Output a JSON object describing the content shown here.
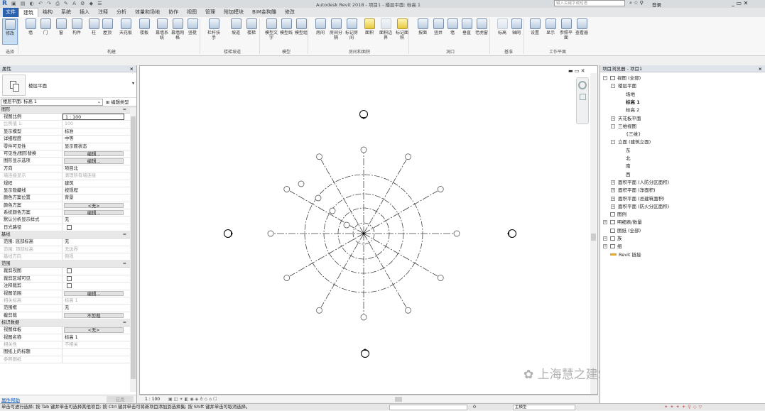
{
  "app": {
    "title": "Autodesk Revit 2018 -    项目1 - 楼层平面: 标高 1",
    "search_placeholder": "键入关键字或短语",
    "login": "登录"
  },
  "tabs": [
    "建筑",
    "结构",
    "系统",
    "插入",
    "注释",
    "分析",
    "体量和场地",
    "协作",
    "视图",
    "管理",
    "附加模块",
    "BIM金狗雕",
    "修改"
  ],
  "ribbon": {
    "buttons": [
      "修改",
      "墙",
      "门",
      "窗",
      "构件",
      "柱",
      "屋顶",
      "天花板",
      "楼板",
      "幕墙系统",
      "幕墙网格",
      "竖梃",
      "栏杆扶手",
      "坡道",
      "楼梯",
      "模型文字",
      "模型线",
      "模型组",
      "房间",
      "房间分隔",
      "标记房间",
      "面积",
      "面积边界",
      "标记面积",
      "按面",
      "竖井",
      "墙",
      "垂直",
      "老虎窗",
      "标高",
      "轴网",
      "设置",
      "显示",
      "参照平面",
      "查看器"
    ],
    "groups": [
      "选择",
      "构建",
      "楼梯坡道",
      "模型",
      "房间和面积",
      "洞口",
      "基准",
      "工作平面"
    ]
  },
  "properties": {
    "title": "属性",
    "type_name": "楼层平面",
    "selector": "楼层平面: 标高 1",
    "edit_type": "编辑类型",
    "sections": [
      {
        "name": "图形",
        "rows": [
          {
            "k": "视图比例",
            "v": "1 : 100"
          },
          {
            "k": "比例值 1:",
            "v": "100",
            "dim": true
          },
          {
            "k": "显示模型",
            "v": "标准"
          },
          {
            "k": "详细程度",
            "v": "中等"
          },
          {
            "k": "零件可见性",
            "v": "显示原状态"
          },
          {
            "k": "可见性/图形替换",
            "btn": "编辑..."
          },
          {
            "k": "图形显示选项",
            "btn": "编辑..."
          },
          {
            "k": "方向",
            "v": "项目北"
          },
          {
            "k": "墙连接显示",
            "v": "清理所有墙连接",
            "dim": true
          },
          {
            "k": "规程",
            "v": "建筑"
          },
          {
            "k": "显示隐藏线",
            "v": "按规程"
          },
          {
            "k": "颜色方案位置",
            "v": "背景"
          },
          {
            "k": "颜色方案",
            "btn": "<无>"
          },
          {
            "k": "系统颜色方案",
            "btn": "编辑..."
          },
          {
            "k": "默认分析显示样式",
            "v": "无"
          },
          {
            "k": "日光路径",
            "cb": true
          }
        ]
      },
      {
        "name": "基线",
        "rows": [
          {
            "k": "范围: 底部标高",
            "v": "无"
          },
          {
            "k": "范围: 顶部标高",
            "v": "无边界",
            "dim": true
          },
          {
            "k": "基线方向",
            "v": "俯视",
            "dim": true
          }
        ]
      },
      {
        "name": "范围",
        "rows": [
          {
            "k": "裁剪视图",
            "cb": true
          },
          {
            "k": "裁剪区域可见",
            "cb": true
          },
          {
            "k": "注释裁剪",
            "cb": true
          },
          {
            "k": "视图范围",
            "btn": "编辑..."
          },
          {
            "k": "相关标高",
            "v": "标高 1",
            "dim": true
          },
          {
            "k": "范围框",
            "v": "无"
          },
          {
            "k": "截剪裁",
            "btn": "不剪裁"
          }
        ]
      },
      {
        "name": "标识数据",
        "rows": [
          {
            "k": "视图样板",
            "btn": "<无>"
          },
          {
            "k": "视图名称",
            "v": "标高 1"
          },
          {
            "k": "相关性",
            "v": "不相关",
            "dim": true
          },
          {
            "k": "图纸上的标题",
            "v": ""
          },
          {
            "k": "参照图纸",
            "v": "",
            "dim": true
          }
        ]
      }
    ],
    "help": "属性帮助",
    "apply": "应用"
  },
  "view_bar": {
    "scale": "1 : 100"
  },
  "browser": {
    "title": "项目浏览器 - 项目1",
    "nodes": [
      {
        "t": "视图 (全部)",
        "d": 0,
        "e": "-"
      },
      {
        "t": "楼层平面",
        "d": 1,
        "e": "-"
      },
      {
        "t": "场地",
        "d": 2
      },
      {
        "t": "标高 1",
        "d": 2,
        "b": true
      },
      {
        "t": "标高 2",
        "d": 2
      },
      {
        "t": "天花板平面",
        "d": 1,
        "e": "+"
      },
      {
        "t": "三维视图",
        "d": 1,
        "e": "-"
      },
      {
        "t": "{三维}",
        "d": 2
      },
      {
        "t": "立面 (建筑立面)",
        "d": 1,
        "e": "-"
      },
      {
        "t": "东",
        "d": 2
      },
      {
        "t": "北",
        "d": 2
      },
      {
        "t": "南",
        "d": 2
      },
      {
        "t": "西",
        "d": 2
      },
      {
        "t": "面积平面 (人防分区面积)",
        "d": 1,
        "e": "+"
      },
      {
        "t": "面积平面 (净面积)",
        "d": 1,
        "e": "+"
      },
      {
        "t": "面积平面 (总建筑面积)",
        "d": 1,
        "e": "+"
      },
      {
        "t": "面积平面 (防火分区面积)",
        "d": 1,
        "e": "+"
      },
      {
        "t": "图例",
        "d": 0
      },
      {
        "t": "明细表/数量",
        "d": 0,
        "e": "+"
      },
      {
        "t": "图纸 (全部)",
        "d": 0
      },
      {
        "t": "族",
        "d": 0,
        "e": "+"
      },
      {
        "t": "组",
        "d": 0,
        "e": "+"
      },
      {
        "t": "Revit 链接",
        "d": 0
      }
    ]
  },
  "status": {
    "text": "单击可进行选择; 按 Tab 键并单击可选择其他项目; 按 Ctrl 键并单击可将新项目添加到选择集; 按 Shift 键并单击可取消选择。",
    "workset": "主模型",
    "zero": "0"
  },
  "watermark": "上海慧之建SmartBIM"
}
